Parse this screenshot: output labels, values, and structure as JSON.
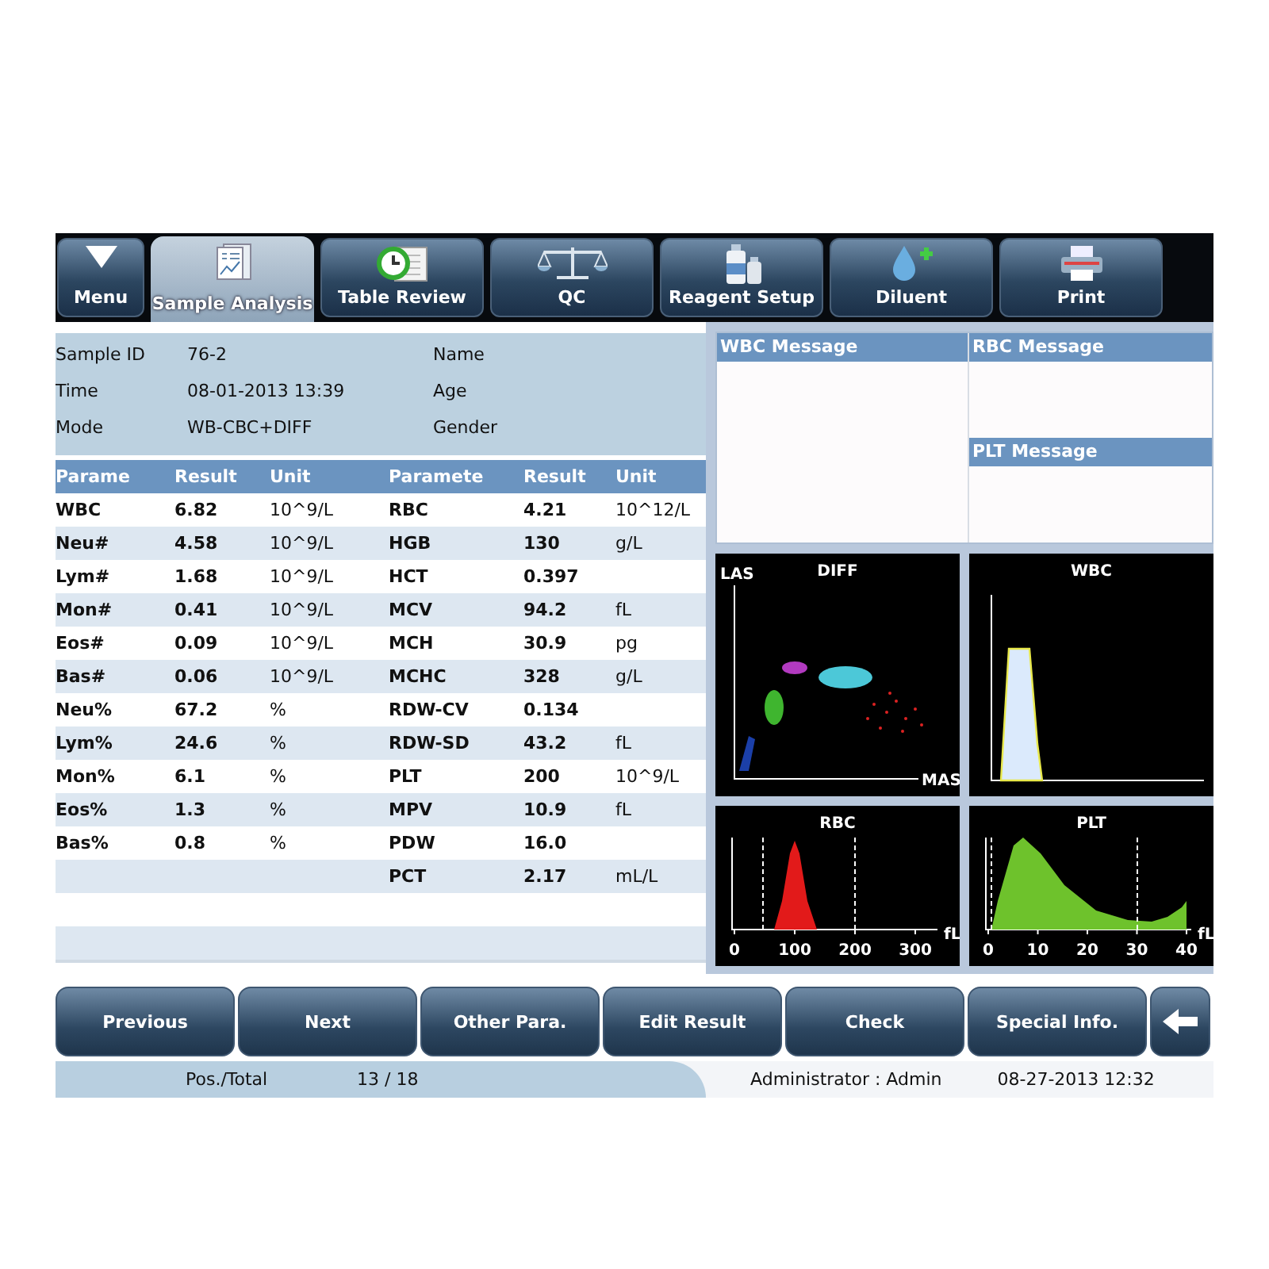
{
  "toolbar": {
    "tabs": [
      {
        "label": "Menu",
        "selected": false
      },
      {
        "label": "Sample Analysis",
        "selected": true
      },
      {
        "label": "Table Review",
        "selected": false
      },
      {
        "label": "QC",
        "selected": false
      },
      {
        "label": "Reagent Setup",
        "selected": false
      },
      {
        "label": "Diluent",
        "selected": false
      },
      {
        "label": "Print",
        "selected": false
      }
    ]
  },
  "sample_info": {
    "left": [
      {
        "label": "Sample ID",
        "value": "76-2"
      },
      {
        "label": "Time",
        "value": "08-01-2013 13:39"
      },
      {
        "label": "Mode",
        "value": "WB-CBC+DIFF"
      }
    ],
    "right": [
      {
        "label": "Name"
      },
      {
        "label": "Age"
      },
      {
        "label": "Gender"
      }
    ]
  },
  "results": {
    "columns": [
      "Parame",
      "Result",
      "Unit",
      "Paramete",
      "Result",
      "Unit"
    ],
    "rows": [
      {
        "left": {
          "name": "WBC",
          "result": "6.82",
          "unit": "10^9/L"
        },
        "right": {
          "name": "RBC",
          "result": "4.21",
          "unit": "10^12/L"
        }
      },
      {
        "left": {
          "name": "Neu#",
          "result": "4.58",
          "unit": "10^9/L"
        },
        "right": {
          "name": "HGB",
          "result": "130",
          "unit": "g/L"
        }
      },
      {
        "left": {
          "name": "Lym#",
          "result": "1.68",
          "unit": "10^9/L"
        },
        "right": {
          "name": "HCT",
          "result": "0.397"
        }
      },
      {
        "left": {
          "name": "Mon#",
          "result": "0.41",
          "unit": "10^9/L"
        },
        "right": {
          "name": "MCV",
          "result": "94.2",
          "unit": "fL"
        }
      },
      {
        "left": {
          "name": "Eos#",
          "result": "0.09",
          "unit": "10^9/L"
        },
        "right": {
          "name": "MCH",
          "result": "30.9",
          "unit": "pg"
        }
      },
      {
        "left": {
          "name": "Bas#",
          "result": "0.06",
          "unit": "10^9/L"
        },
        "right": {
          "name": "MCHC",
          "result": "328",
          "unit": "g/L"
        }
      },
      {
        "left": {
          "name": "Neu%",
          "result": "67.2",
          "unit": "%"
        },
        "right": {
          "name": "RDW-CV",
          "result": "0.134"
        }
      },
      {
        "left": {
          "name": "Lym%",
          "result": "24.6",
          "unit": "%"
        },
        "right": {
          "name": "RDW-SD",
          "result": "43.2",
          "unit": "fL"
        }
      },
      {
        "left": {
          "name": "Mon%",
          "result": "6.1",
          "unit": "%"
        },
        "right": {
          "name": "PLT",
          "result": "200",
          "unit": "10^9/L"
        }
      },
      {
        "left": {
          "name": "Eos%",
          "result": "1.3",
          "unit": "%"
        },
        "right": {
          "name": "MPV",
          "result": "10.9",
          "unit": "fL"
        }
      },
      {
        "left": {
          "name": "Bas%",
          "result": "0.8",
          "unit": "%"
        },
        "right": {
          "name": "PDW",
          "result": "16.0"
        }
      },
      {
        "right": {
          "name": "PCT",
          "result": "2.17",
          "unit": "mL/L"
        }
      }
    ]
  },
  "messages": [
    {
      "title": "WBC Message"
    },
    {
      "title": "RBC Message"
    },
    {
      "title": "PLT Message"
    }
  ],
  "charts": [
    {
      "kind": "diff-scatter",
      "title": "DIFF",
      "y_axis_label": "LAS",
      "x_axis_label": "MAS"
    },
    {
      "kind": "wbc-histogram",
      "title": "WBC"
    },
    {
      "kind": "rbc-histogram",
      "title": "RBC",
      "tick_labels": [
        "0",
        "100",
        "200",
        "300"
      ],
      "unit": "fL"
    },
    {
      "kind": "plt-histogram",
      "title": "PLT",
      "tick_labels": [
        "0",
        "10",
        "20",
        "30",
        "40"
      ],
      "unit": "fL"
    }
  ],
  "actions": [
    {
      "kind": "text",
      "label": "Previous"
    },
    {
      "kind": "text",
      "label": "Next"
    },
    {
      "kind": "text",
      "label": "Other Para."
    },
    {
      "kind": "text",
      "label": "Edit Result"
    },
    {
      "kind": "text",
      "label": "Check"
    },
    {
      "kind": "text",
      "label": "Special Info."
    },
    {
      "kind": "icon"
    }
  ],
  "status_bar": {
    "position_label": "Pos./Total",
    "position": "13 / 18",
    "user": "Administrator : Admin",
    "datetime": "08-27-2013 12:32"
  }
}
